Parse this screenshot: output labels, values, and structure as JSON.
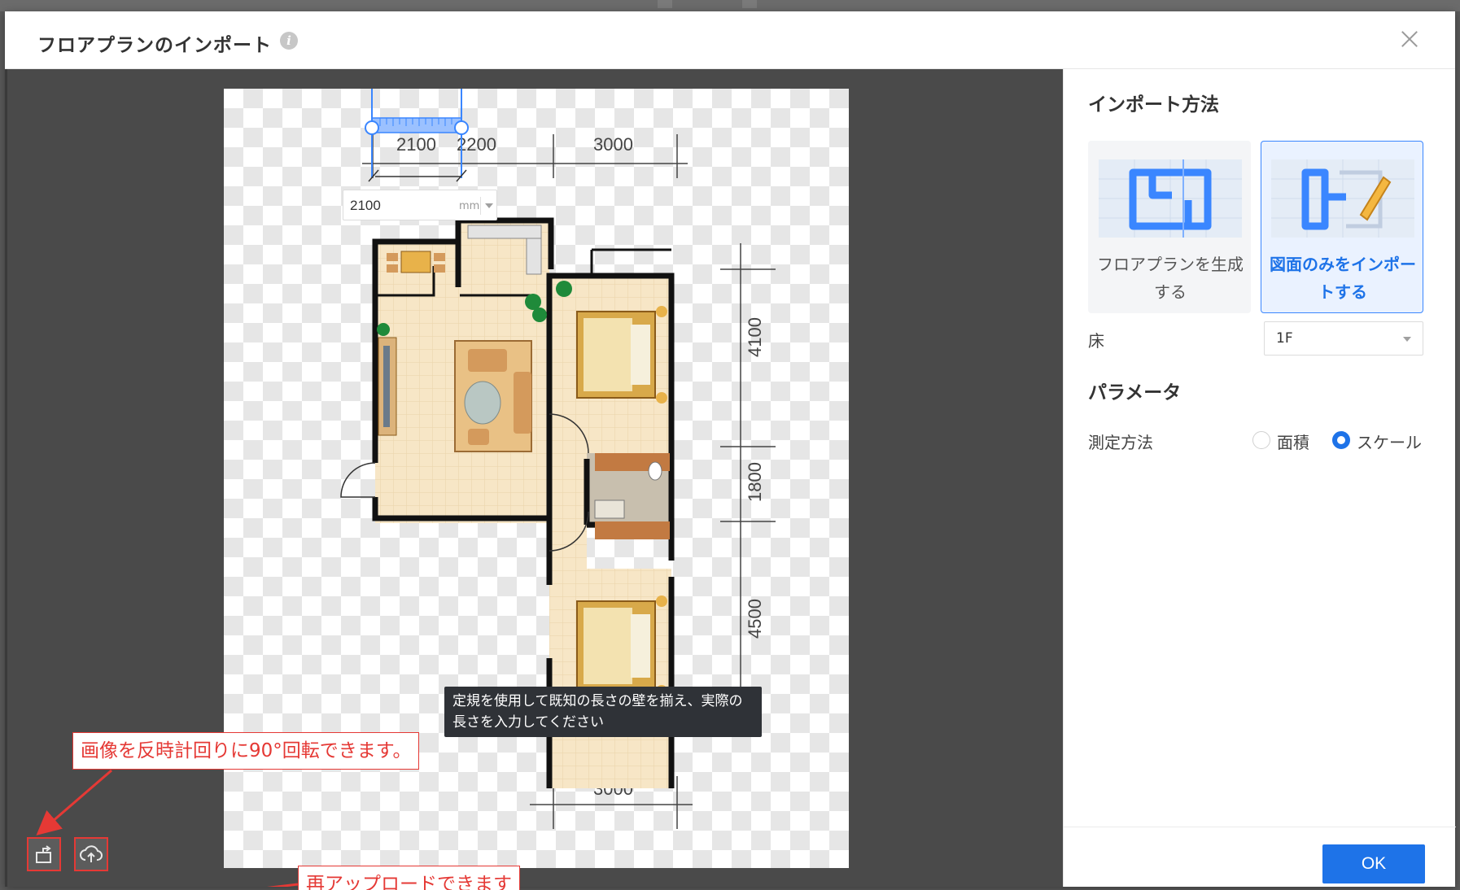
{
  "dialog": {
    "title": "フロアプランのインポート",
    "info_icon": "i"
  },
  "canvas": {
    "scale_input": {
      "value": "2100",
      "unit": "mm"
    },
    "tooltip": "定規を使用して既知の長さの壁を揃え、実際の長さを入力してください",
    "callouts": {
      "rotate": "画像を反時計回りに90°回転できます。",
      "upload": "再アップロードできます"
    },
    "floorplan_dimensions": {
      "top": [
        "2100",
        "2200",
        "3000"
      ],
      "right": [
        "4100",
        "1800",
        "4500"
      ],
      "bottom": [
        "3000"
      ]
    },
    "tools": {
      "rotate_icon": "rotate-left-icon",
      "upload_icon": "cloud-upload-icon"
    }
  },
  "panel": {
    "import_method_title": "インポート方法",
    "methods": [
      {
        "label": "フロアプランを生成する",
        "active": false
      },
      {
        "label": "図面のみをインポートする",
        "active": true
      }
    ],
    "floor": {
      "label": "床",
      "value": "1F"
    },
    "params_title": "パラメータ",
    "measure": {
      "label": "測定方法",
      "options": [
        {
          "label": "面積",
          "checked": false
        },
        {
          "label": "スケール",
          "checked": true
        }
      ]
    },
    "ok_label": "OK"
  },
  "colors": {
    "accent": "#1e73e8",
    "annotation_red": "#e53935",
    "canvas_bg": "#4a4a4a",
    "floor_tile": "#f7e6c6",
    "wall": "#111111"
  }
}
